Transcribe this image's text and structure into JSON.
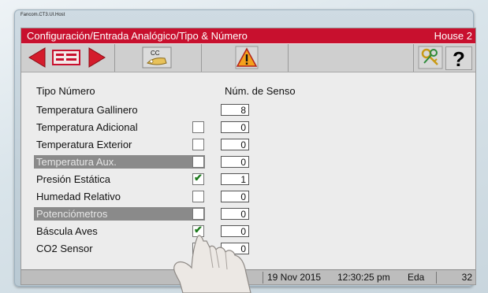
{
  "host_title": "Fancom.CT3.UI.Host",
  "titlebar": {
    "path": "Configuración/Entrada Analógico/Tipo & Número",
    "house": "House 2"
  },
  "toolbar": {
    "prev_icon": "arrow-left-icon",
    "list_icon": "list-icon",
    "next_icon": "arrow-right-icon",
    "cc_icon": "copy-config-icon",
    "cc_label": "CC",
    "alarm_icon": "warning-icon",
    "keys_icon": "keys-icon",
    "help_icon": "help-icon",
    "help_label": "?"
  },
  "headers": {
    "type": "Tipo  Número",
    "sensor": "Núm. de Senso"
  },
  "rows": [
    {
      "label": "Temperatura Gallinero",
      "checkbox": null,
      "value": "8",
      "disabled": false
    },
    {
      "label": "Temperatura Adicional",
      "checkbox": false,
      "value": "0",
      "disabled": false
    },
    {
      "label": "Temperatura Exterior",
      "checkbox": false,
      "value": "0",
      "disabled": false
    },
    {
      "label": "Temperatura Aux.",
      "checkbox": false,
      "value": "0",
      "disabled": true
    },
    {
      "label": "Presión Estática",
      "checkbox": true,
      "value": "1",
      "disabled": false
    },
    {
      "label": "Humedad Relativo",
      "checkbox": false,
      "value": "0",
      "disabled": false
    },
    {
      "label": "Potenciómetros",
      "checkbox": false,
      "value": "0",
      "disabled": true
    },
    {
      "label": "Báscula Aves",
      "checkbox": true,
      "value": "0",
      "disabled": false
    },
    {
      "label": "CO2 Sensor",
      "checkbox": false,
      "value": "0",
      "disabled": false
    }
  ],
  "status": {
    "date": "19 Nov 2015",
    "time": "12:30:25 pm",
    "age_label": "Eda",
    "age_value": "32"
  },
  "colors": {
    "titlebar": "#c8102e",
    "arrows": "#d41c2c",
    "check": "#1c7a1c"
  }
}
